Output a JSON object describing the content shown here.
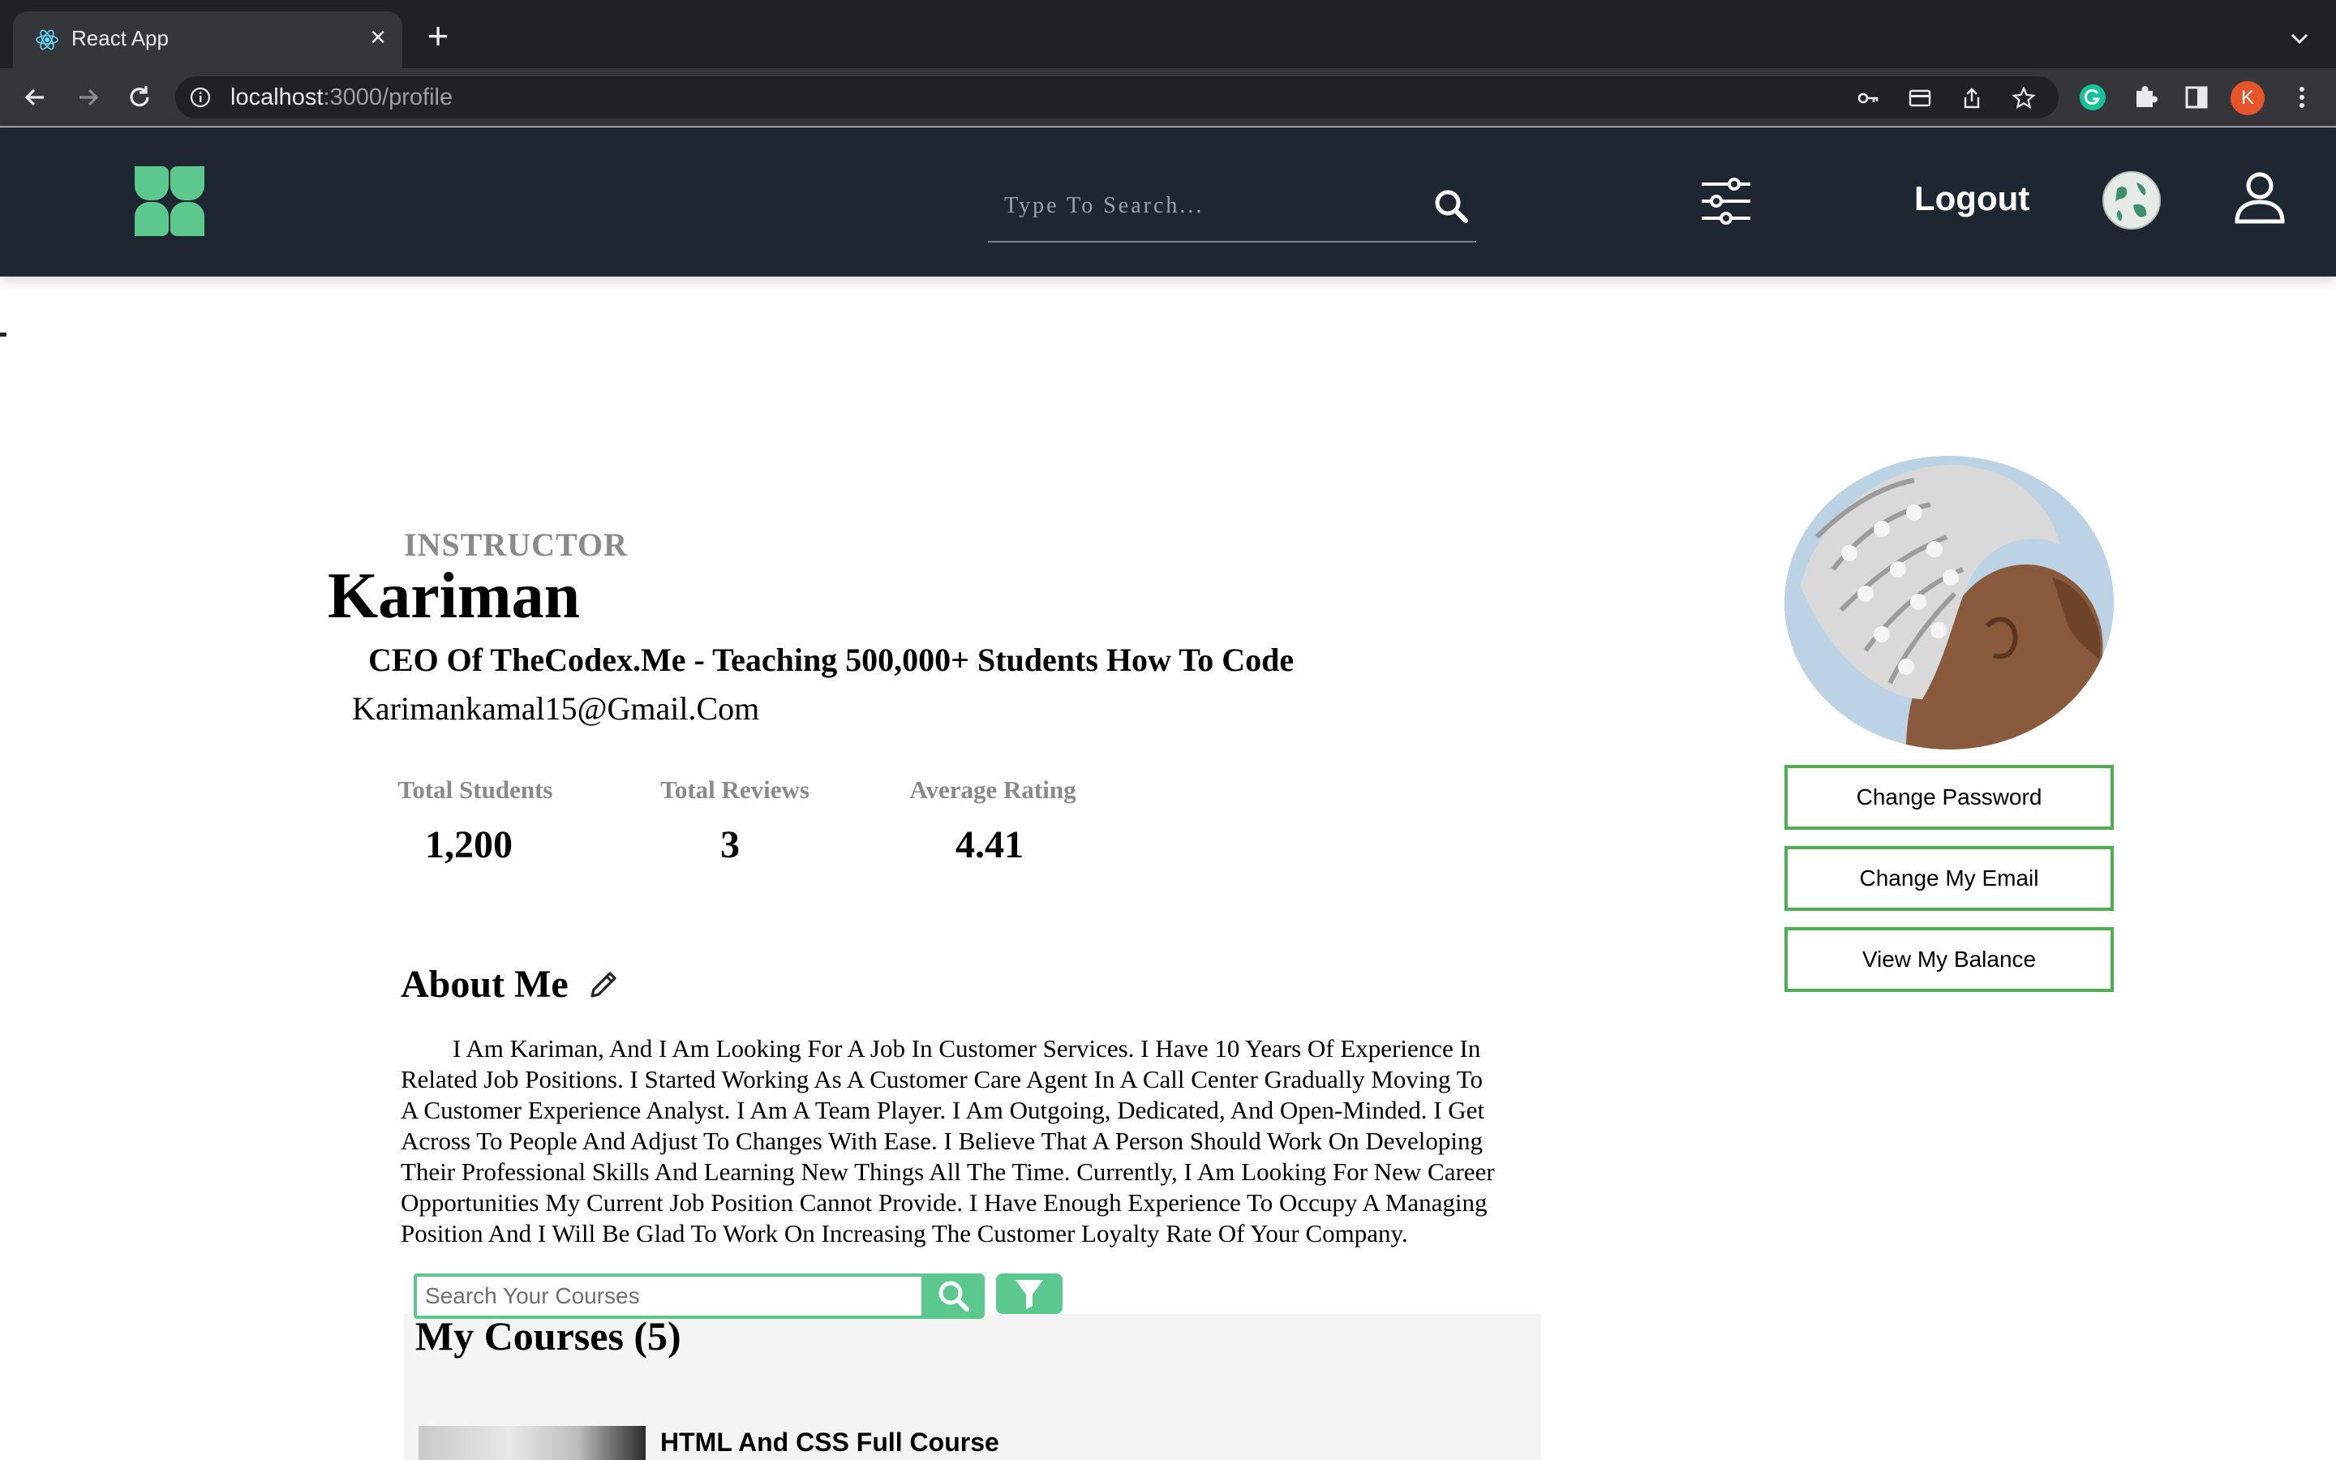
{
  "browser": {
    "tab_title": "React App",
    "tab_close": "×",
    "new_tab": "+",
    "url_host": "localhost",
    "url_path": ":3000/profile",
    "profile_initial": "K"
  },
  "header": {
    "search_placeholder": "Type To Search...",
    "logout_label": "Logout"
  },
  "profile": {
    "role": "INSTRUCTOR",
    "name": "Kariman",
    "headline": "CEO Of TheCodex.Me - Teaching 500,000+ Students How To Code",
    "email": "Karimankamal15@Gmail.Com",
    "stats": [
      {
        "label": "Total Students",
        "value": "1,200"
      },
      {
        "label": "Total Reviews",
        "value": "3"
      },
      {
        "label": "Average Rating",
        "value": "4.41"
      }
    ],
    "about_title": "About Me",
    "about_text": "I Am Kariman, And I Am Looking For A Job In Customer Services. I Have 10 Years Of Experience In Related Job Positions. I Started Working As A Customer Care Agent In A Call Center Gradually Moving To A Customer Experience Analyst. I Am A Team Player. I Am Outgoing, Dedicated, And Open-Minded. I Get Across To People And Adjust To Changes With Ease. I Believe That A Person Should Work On Developing Their Professional Skills And Learning New Things All The Time. Currently, I Am Looking For New Career Opportunities My Current Job Position Cannot Provide. I Have Enough Experience To Occupy A Managing Position And I Will Be Glad To Work On Increasing The Customer Loyalty Rate Of Your Company."
  },
  "actions": {
    "change_password": "Change Password",
    "change_email": "Change My Email",
    "view_balance": "View My Balance"
  },
  "courses": {
    "search_placeholder": "Search Your Courses",
    "title": "My Courses (5)",
    "items": [
      {
        "name": "HTML And CSS Full Course"
      }
    ]
  },
  "colors": {
    "header_bg": "#1e2632",
    "accent_green": "#5bc98e",
    "button_border": "#4caf50",
    "muted_text": "#8a8a8a"
  }
}
